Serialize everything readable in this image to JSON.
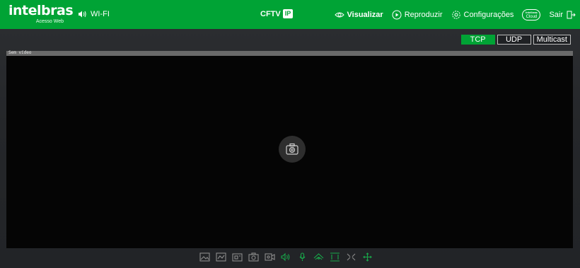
{
  "header": {
    "brand_name": "intelbras",
    "brand_sub": "Acesso Web",
    "wifi_label": "WI-FI",
    "cftv_label": "CFTV",
    "cftv_badge": "IP",
    "nav": {
      "visualizar": "Visualizar",
      "reproduzir": "Reproduzir",
      "configuracoes": "Configurações",
      "cloud_top": "Intelbras",
      "cloud_bottom": "Cloud",
      "sair": "Sair"
    }
  },
  "protocols": {
    "tcp": "TCP",
    "udp": "UDP",
    "multicast": "Multicast",
    "selected": "TCP"
  },
  "video": {
    "status_label": "Sem vídeo"
  },
  "toolbar": {
    "icons": [
      "image-adjust-icon",
      "image-adjust-alt-icon",
      "zoom-window-icon",
      "snapshot-icon",
      "record-icon",
      "audio-icon",
      "microphone-icon",
      "ptz-icon",
      "fullscreen-icon",
      "fit-icon",
      "move-icon"
    ]
  },
  "colors": {
    "brand_green": "#00a335",
    "toolbar_green": "#18a84a"
  }
}
